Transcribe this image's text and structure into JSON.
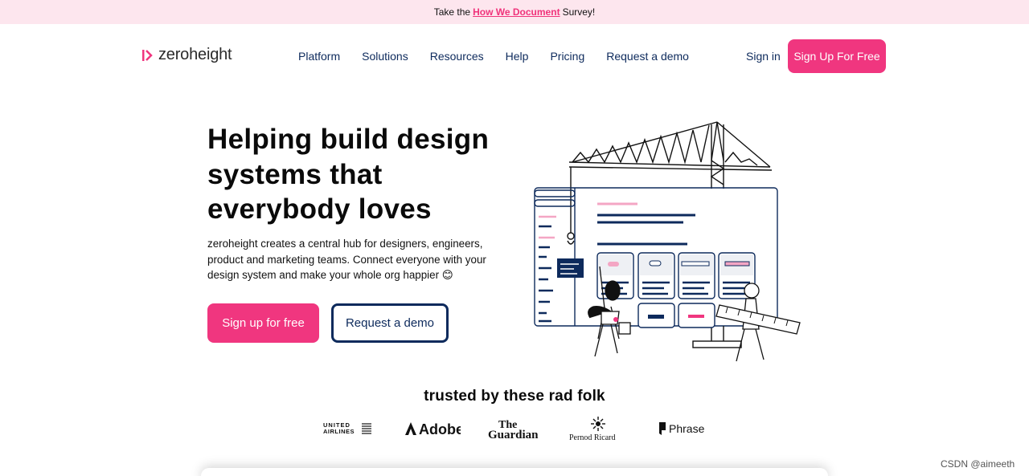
{
  "banner": {
    "prefix": "Take the",
    "link": "How We Document",
    "suffix": "Survey!"
  },
  "nav": {
    "logo": "zeroheight",
    "links": [
      "Platform",
      "Solutions",
      "Resources",
      "Help",
      "Pricing",
      "Request a demo"
    ],
    "sign_in": "Sign in",
    "signup": "Sign Up For Free"
  },
  "hero": {
    "title": "Helping build design systems that everybody loves",
    "description": "zeroheight creates a central hub for designers, engineers, product and marketing teams. Connect everyone with your design system and make your whole org happier",
    "emoji": "😊",
    "primary_cta": "Sign up for free",
    "secondary_cta": "Request a demo"
  },
  "trusted": {
    "title": "trusted by these rad folk",
    "brands": [
      "UNITED AIRLINES",
      "Adobe",
      "The Guardian",
      "Pernod Ricard",
      "Phrase"
    ]
  },
  "watermark": "CSDN @aimeeth",
  "colors": {
    "accent": "#f0367f",
    "navy": "#0d2a5c",
    "banner_bg": "#fde6ee"
  }
}
